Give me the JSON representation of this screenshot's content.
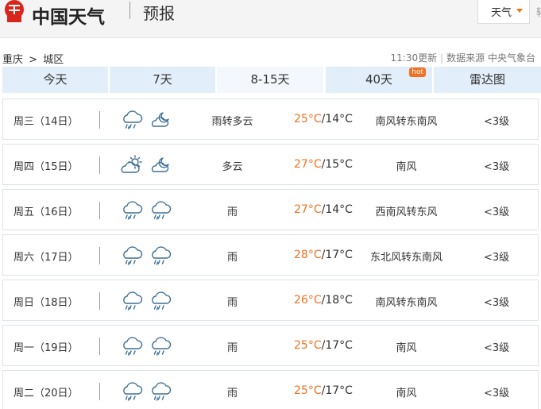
{
  "header": {
    "logo_text": "中国天气",
    "title": "预报",
    "dropdown_label": "天气",
    "cut_text": "转"
  },
  "breadcrumb": {
    "city": "重庆",
    "separator": ">",
    "district": "城区"
  },
  "meta": {
    "update": "11:30更新",
    "source": "数据来源 中央气象台"
  },
  "tabs": [
    {
      "label": "今天"
    },
    {
      "label": "7天"
    },
    {
      "label": "8-15天",
      "active": true
    },
    {
      "label": "40天",
      "badge": "hot"
    },
    {
      "label": "雷达图"
    }
  ],
  "colors": {
    "accent_orange": "#f37020",
    "tab_bg": "#e2eefa",
    "tab_active_bg": "#f4f8fc",
    "icon_blue": "#3d6f96"
  },
  "forecast": [
    {
      "day": "周三（14日）",
      "icon1": "rain-cloud-icon",
      "icon2": "cloudy-night-icon",
      "weather": "雨转多云",
      "high": "25°C",
      "low": "14°C",
      "wind": "南风转东南风",
      "level": "<3级"
    },
    {
      "day": "周四（15日）",
      "icon1": "sun-cloud-icon",
      "icon2": "cloudy-night-icon",
      "weather": "多云",
      "high": "27°C",
      "low": "15°C",
      "wind": "南风",
      "level": "<3级"
    },
    {
      "day": "周五（16日）",
      "icon1": "rain-cloud-icon",
      "icon2": "rain-cloud-icon",
      "weather": "雨",
      "high": "27°C",
      "low": "14°C",
      "wind": "西南风转东风",
      "level": "<3级"
    },
    {
      "day": "周六（17日）",
      "icon1": "rain-cloud-icon",
      "icon2": "rain-cloud-icon",
      "weather": "雨",
      "high": "28°C",
      "low": "17°C",
      "wind": "东北风转东南风",
      "level": "<3级"
    },
    {
      "day": "周日（18日）",
      "icon1": "rain-cloud-icon",
      "icon2": "rain-cloud-icon",
      "weather": "雨",
      "high": "26°C",
      "low": "18°C",
      "wind": "南风转东南风",
      "level": "<3级"
    },
    {
      "day": "周一（19日）",
      "icon1": "rain-cloud-icon",
      "icon2": "rain-cloud-icon",
      "weather": "雨",
      "high": "25°C",
      "low": "17°C",
      "wind": "南风",
      "level": "<3级"
    },
    {
      "day": "周二（20日）",
      "icon1": "rain-cloud-icon",
      "icon2": "rain-cloud-icon",
      "weather": "雨",
      "high": "25°C",
      "low": "17°C",
      "wind": "南风",
      "level": "<3级"
    }
  ]
}
